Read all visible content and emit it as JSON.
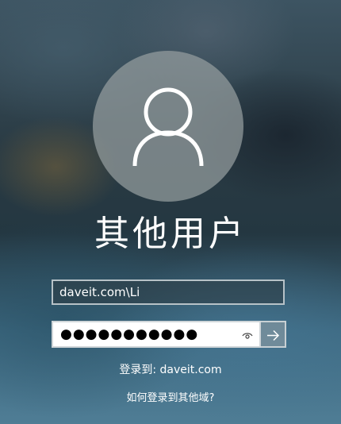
{
  "user": {
    "display_name": "其他用户"
  },
  "login": {
    "username_value": "daveit.com\\Li",
    "password_mask": "●●●●●●●●●●●",
    "signin_to_text": "登录到: daveit.com",
    "other_domain_link": "如何登录到其他域?"
  },
  "icons": {
    "avatar": "user-silhouette-icon",
    "reveal": "eye-icon",
    "submit": "arrow-right-icon"
  }
}
